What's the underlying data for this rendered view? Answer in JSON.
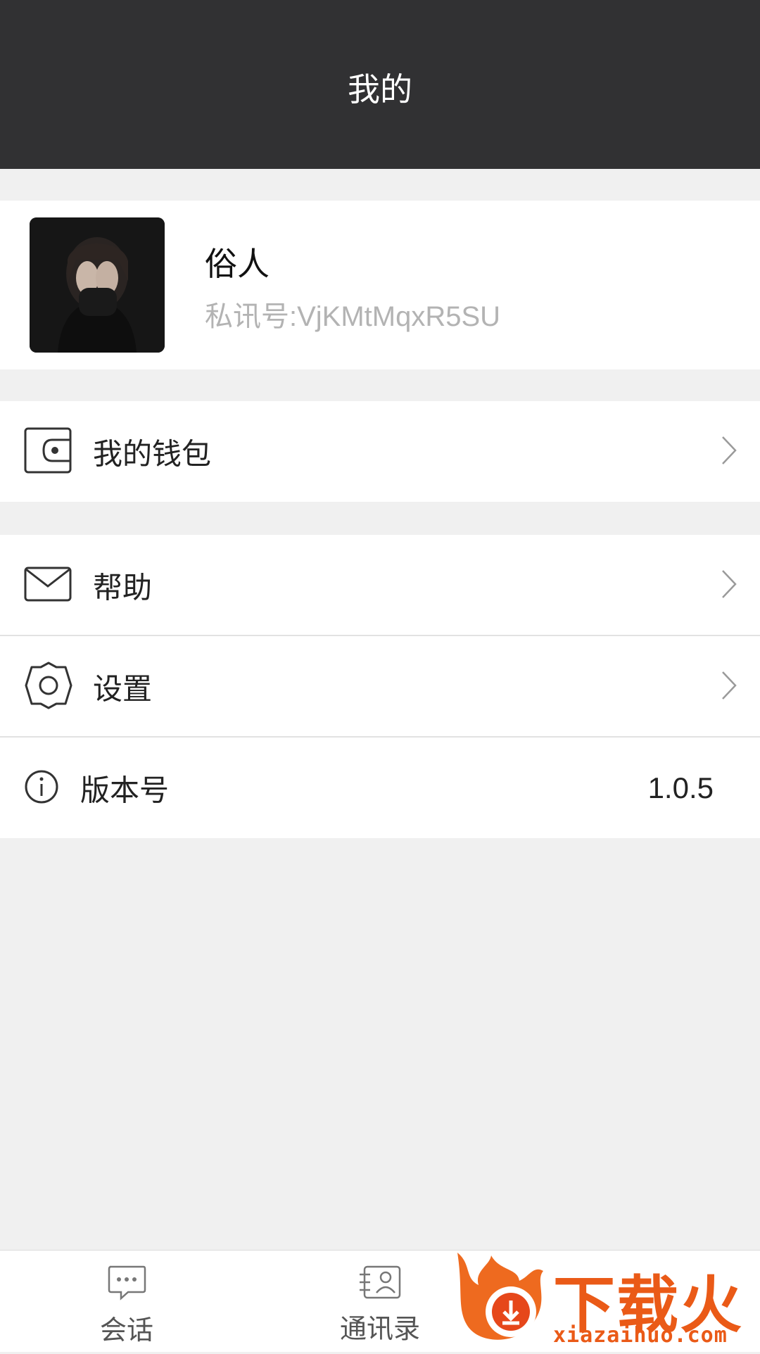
{
  "header": {
    "title": "我的"
  },
  "profile": {
    "name": "俗人",
    "account_id": "私讯号:VjKMtMqxR5SU"
  },
  "menu": {
    "wallet": {
      "label": "我的钱包",
      "icon": "wallet-icon"
    },
    "help": {
      "label": "帮助",
      "icon": "mail-icon"
    },
    "settings": {
      "label": "设置",
      "icon": "gear-icon"
    },
    "version": {
      "label": "版本号",
      "value": "1.0.5",
      "icon": "info-icon"
    }
  },
  "tabbar": {
    "tabs": [
      {
        "label": "会话",
        "icon": "chat-icon"
      },
      {
        "label": "通讯录",
        "icon": "contacts-icon"
      }
    ]
  },
  "watermark": {
    "text": "下载火",
    "url": "xiazaihuo.com"
  },
  "colors": {
    "header_bg": "#313133",
    "page_bg": "#f0f0f0",
    "accent_watermark": "#ea5a17"
  }
}
